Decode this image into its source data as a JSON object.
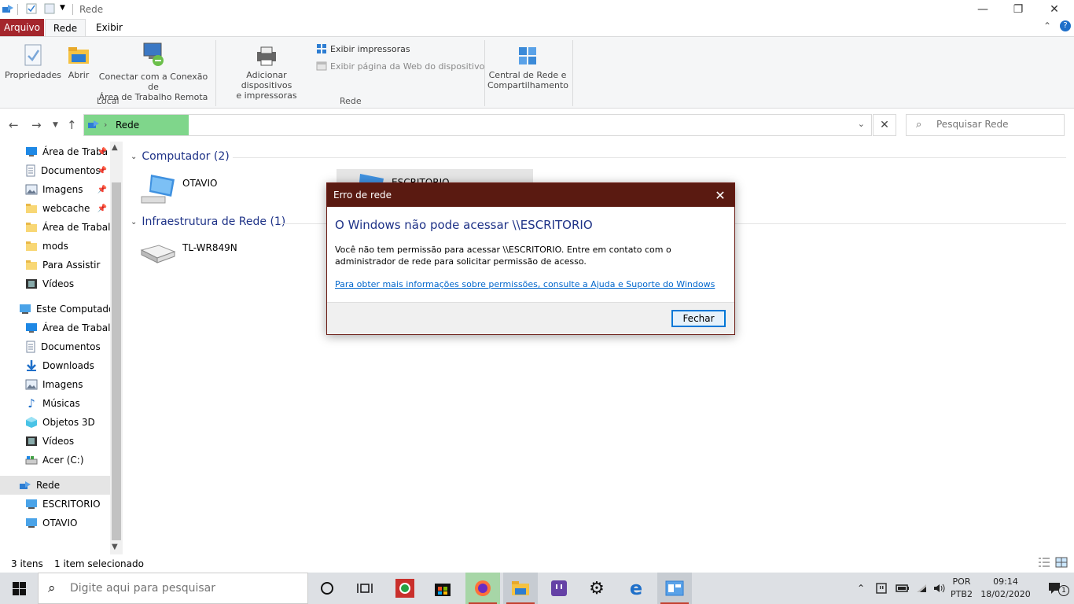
{
  "window": {
    "title": "Rede",
    "minimize": "—",
    "maximize": "❐",
    "close": "✕"
  },
  "tabs": {
    "file": "Arquivo",
    "items": [
      "Rede",
      "Exibir"
    ],
    "collapse": "⌃",
    "help": "?"
  },
  "ribbon": {
    "properties": "Propriedades",
    "open": "Abrir",
    "remote_line1": "Conectar com a Conexão de",
    "remote_line2": "Área de Trabalho Remota",
    "group_local": "Local",
    "add_devices_line1": "Adicionar dispositivos",
    "add_devices_line2": "e impressoras",
    "show_printers": "Exibir impressoras",
    "device_web": "Exibir página da Web do dispositivo",
    "group_network": "Rede",
    "net_center_line1": "Central de Rede e",
    "net_center_line2": "Compartilhamento"
  },
  "address": {
    "crumb": "Rede",
    "search_placeholder": "Pesquisar Rede"
  },
  "nav": {
    "quick": [
      {
        "label": "Área de Traba",
        "pinned": true
      },
      {
        "label": "Documentos",
        "pinned": true
      },
      {
        "label": "Imagens",
        "pinned": true
      },
      {
        "label": "webcache",
        "pinned": true
      },
      {
        "label": "Área de Trabalho",
        "pinned": false
      },
      {
        "label": "mods",
        "pinned": false
      },
      {
        "label": "Para Assistir",
        "pinned": false
      },
      {
        "label": "Vídeos",
        "pinned": false
      }
    ],
    "this_pc": "Este Computador",
    "pc_items": [
      "Área de Trabalho",
      "Documentos",
      "Downloads",
      "Imagens",
      "Músicas",
      "Objetos 3D",
      "Vídeos",
      "Acer (C:)"
    ],
    "network": "Rede",
    "net_items": [
      "ESCRITORIO",
      "OTAVIO"
    ],
    "pin_glyph": "📌"
  },
  "content": {
    "section1": "Computador (2)",
    "section2": "Infraestrutura de Rede (1)",
    "computers": [
      "OTAVIO",
      "ESCRITORIO"
    ],
    "infra": [
      "TL-WR849N"
    ]
  },
  "status": {
    "count": "3 itens",
    "selected": "1 item selecionado"
  },
  "dialog": {
    "title": "Erro de rede",
    "heading": "O Windows não pode acessar \\\\ESCRITORIO",
    "message": "Você não tem permissão para acessar \\\\ESCRITORIO. Entre em contato com o administrador de rede para solicitar permissão de acesso.",
    "link": "Para obter mais informações sobre permissões, consulte a Ajuda e Suporte do Windows",
    "button": "Fechar"
  },
  "taskbar": {
    "search_placeholder": "Digite aqui para pesquisar",
    "lang_top": "POR",
    "lang_bottom": "PTB2",
    "time": "09:14",
    "date": "18/02/2020",
    "notif_count": "1"
  }
}
